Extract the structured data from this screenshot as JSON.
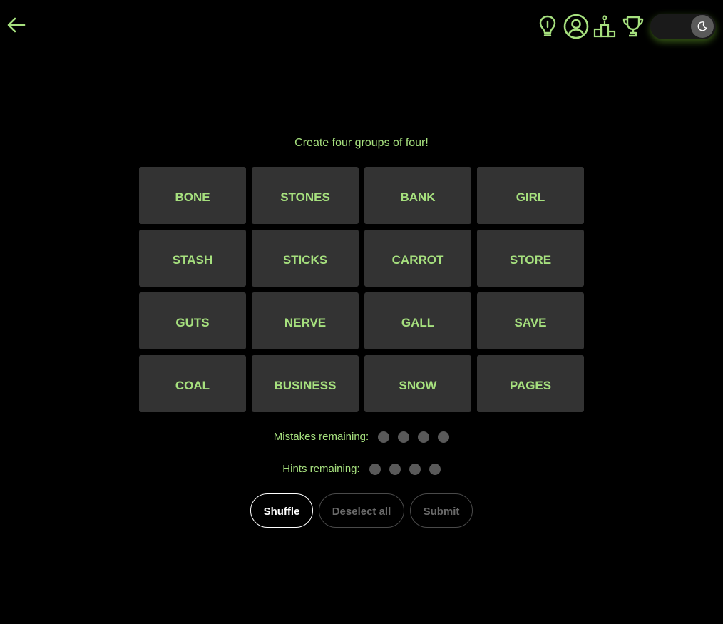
{
  "theme": {
    "accent": "#a6e07e",
    "background": "#000000",
    "tile_background": "#333333",
    "dot_color": "#595959"
  },
  "header": {
    "back_icon": "arrow-left-icon",
    "icons": [
      "lightbulb-hint-icon",
      "user-profile-icon",
      "podium-leaderboard-icon",
      "trophy-icon"
    ],
    "theme_toggle": {
      "icon": "moon-icon",
      "state": "dark"
    }
  },
  "game": {
    "instruction": "Create four groups of four!",
    "tiles": [
      [
        "BONE",
        "STONES",
        "BANK",
        "GIRL"
      ],
      [
        "STASH",
        "STICKS",
        "CARROT",
        "STORE"
      ],
      [
        "GUTS",
        "NERVE",
        "GALL",
        "SAVE"
      ],
      [
        "COAL",
        "BUSINESS",
        "SNOW",
        "PAGES"
      ]
    ]
  },
  "status": {
    "mistakes_label": "Mistakes remaining:",
    "mistakes_remaining": 4,
    "hints_label": "Hints remaining:",
    "hints_remaining": 4
  },
  "actions": {
    "shuffle_label": "Shuffle",
    "deselect_label": "Deselect all",
    "submit_label": "Submit"
  }
}
